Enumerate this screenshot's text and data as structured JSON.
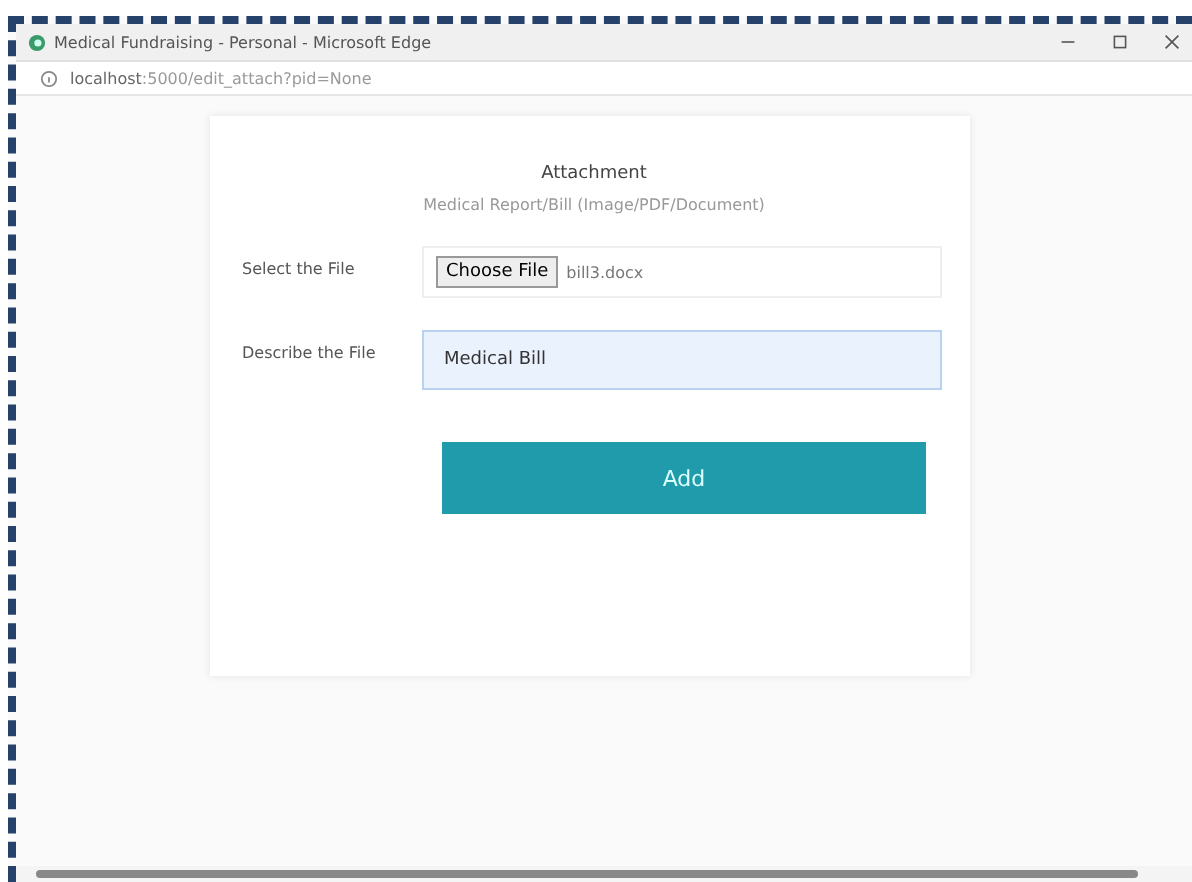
{
  "window": {
    "title": "Medical Fundraising - Personal - Microsoft Edge"
  },
  "address_bar": {
    "host": "localhost",
    "path": ":5000/edit_attach?pid=None"
  },
  "form": {
    "title": "Attachment",
    "subtitle": "Medical Report/Bill (Image/PDF/Document)",
    "file_label": "Select the File",
    "file_button": "Choose File",
    "file_name": "bill3.docx",
    "describe_label": "Describe the File",
    "describe_value": "Medical Bill",
    "describe_focused": true,
    "submit": "Add"
  }
}
